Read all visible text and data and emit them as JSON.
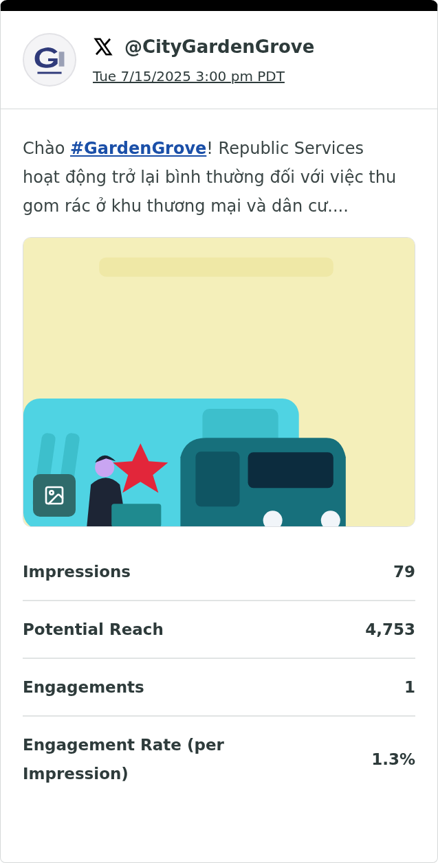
{
  "post": {
    "handle": "@CityGardenGrove",
    "timestamp": "Tue 7/15/2025 3:00 pm PDT",
    "text_before": "Chào ",
    "hashtag": "#GardenGrove",
    "text_after": "! Republic Services hoạt động trở lại bình thường đối với việc thu gom rác ở khu thương mại và dân cư...."
  },
  "metrics": [
    {
      "label": "Impressions",
      "value": "79"
    },
    {
      "label": "Potential Reach",
      "value": "4,753"
    },
    {
      "label": "Engagements",
      "value": "1"
    },
    {
      "label": "Engagement Rate (per Impression)",
      "value": "1.3%"
    }
  ]
}
